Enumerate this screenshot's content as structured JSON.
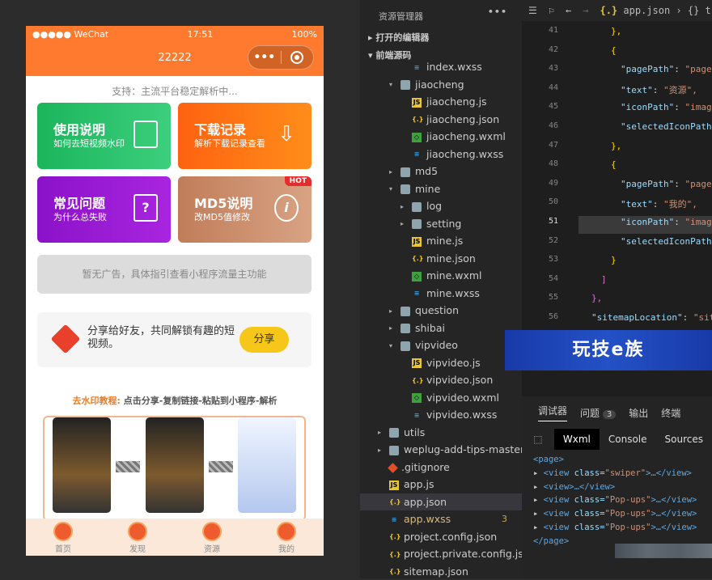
{
  "phone": {
    "status": {
      "carrier": "●●●●● WeChat",
      "time": "17:51",
      "battery": "100%"
    },
    "nav_title": "22222",
    "capsule": {
      "more": "•••"
    },
    "support": "支持：主流平台稳定解析中...",
    "cards": [
      {
        "title": "使用说明",
        "sub": "如何去短视频水印",
        "icon": "book-icon",
        "color": "#1bb55c"
      },
      {
        "title": "下载记录",
        "sub": "解析下载记录查看",
        "icon": "download-icon",
        "color": "#ff6210"
      },
      {
        "title": "常见问题",
        "sub": "为什么总失败",
        "icon": "question-doc-icon",
        "color": "#8b12c9"
      },
      {
        "title": "MD5说明",
        "sub": "改MD5值修改",
        "icon": "info-icon",
        "color": "#c17d5a",
        "badge": "HOT"
      }
    ],
    "ad": "暂无广告，具体指引查看小程序流量主功能",
    "share": {
      "text": "分享给好友，共同解锁有趣的短视频。",
      "button": "分享"
    },
    "tutorial": {
      "title_a": "去水印教程:",
      "title_b": " 点击分享-复制链接-粘贴到小程序-解析"
    },
    "tabs": [
      "首页",
      "发现",
      "资源",
      "我的"
    ]
  },
  "explorer": {
    "title": "资源管理器",
    "more": "•••",
    "sections": [
      "打开的编辑器",
      "前端源码"
    ],
    "tree": [
      {
        "ind": 2,
        "type": "wxss",
        "name": "index.wxss"
      },
      {
        "ind": 1,
        "type": "folder",
        "open": true,
        "name": "jiaocheng"
      },
      {
        "ind": 2,
        "type": "js",
        "name": "jiaocheng.js"
      },
      {
        "ind": 2,
        "type": "json",
        "name": "jiaocheng.json"
      },
      {
        "ind": 2,
        "type": "wxml",
        "name": "jiaocheng.wxml"
      },
      {
        "ind": 2,
        "type": "wxss",
        "name": "jiaocheng.wxss"
      },
      {
        "ind": 1,
        "type": "folder",
        "open": false,
        "name": "md5"
      },
      {
        "ind": 1,
        "type": "folder",
        "open": true,
        "name": "mine"
      },
      {
        "ind": 2,
        "type": "folder",
        "open": false,
        "name": "log"
      },
      {
        "ind": 2,
        "type": "folder",
        "open": false,
        "name": "setting"
      },
      {
        "ind": 2,
        "type": "js",
        "name": "mine.js"
      },
      {
        "ind": 2,
        "type": "json",
        "name": "mine.json"
      },
      {
        "ind": 2,
        "type": "wxml",
        "name": "mine.wxml"
      },
      {
        "ind": 2,
        "type": "wxss",
        "name": "mine.wxss"
      },
      {
        "ind": 1,
        "type": "folder",
        "open": false,
        "name": "question"
      },
      {
        "ind": 1,
        "type": "folder",
        "open": false,
        "name": "shibai"
      },
      {
        "ind": 1,
        "type": "folder",
        "open": true,
        "name": "vipvideo"
      },
      {
        "ind": 2,
        "type": "js",
        "name": "vipvideo.js"
      },
      {
        "ind": 2,
        "type": "json",
        "name": "vipvideo.json"
      },
      {
        "ind": 2,
        "type": "wxml",
        "name": "vipvideo.wxml"
      },
      {
        "ind": 2,
        "type": "wxss",
        "name": "vipvideo.wxss"
      },
      {
        "ind": 0,
        "type": "folder",
        "open": false,
        "name": "utils"
      },
      {
        "ind": 0,
        "type": "folder",
        "open": false,
        "name": "weplug-add-tips-master"
      },
      {
        "ind": 0,
        "type": "git",
        "name": ".gitignore"
      },
      {
        "ind": 0,
        "type": "js",
        "name": "app.js"
      },
      {
        "ind": 0,
        "type": "json",
        "name": "app.json",
        "selected": true
      },
      {
        "ind": 0,
        "type": "wxss",
        "name": "app.wxss",
        "badge": "3"
      },
      {
        "ind": 0,
        "type": "json",
        "name": "project.config.json"
      },
      {
        "ind": 0,
        "type": "json",
        "name": "project.private.config.js..."
      },
      {
        "ind": 0,
        "type": "json",
        "name": "sitemap.json"
      }
    ]
  },
  "editor": {
    "breadcrumb_file": "app.json",
    "breadcrumb_rest": "› {} t",
    "lines": [
      {
        "n": "41",
        "code": [
          {
            "c": "p",
            "t": "},"
          }
        ]
      },
      {
        "n": "42",
        "code": [
          {
            "c": "p",
            "t": "{"
          }
        ]
      },
      {
        "n": "43",
        "code": [
          {
            "c": "k",
            "t": "\"pagePath\""
          },
          {
            "c": "",
            "t": ": "
          },
          {
            "c": "s",
            "t": "\"pages"
          }
        ]
      },
      {
        "n": "44",
        "code": [
          {
            "c": "k",
            "t": "\"text\""
          },
          {
            "c": "",
            "t": ": "
          },
          {
            "c": "s",
            "t": "\"资源\","
          }
        ]
      },
      {
        "n": "45",
        "code": [
          {
            "c": "k",
            "t": "\"iconPath\""
          },
          {
            "c": "",
            "t": ": "
          },
          {
            "c": "s",
            "t": "\"image"
          }
        ]
      },
      {
        "n": "46",
        "code": [
          {
            "c": "k",
            "t": "\"selectedIconPath\""
          }
        ]
      },
      {
        "n": "47",
        "code": [
          {
            "c": "p",
            "t": "},"
          }
        ]
      },
      {
        "n": "48",
        "code": [
          {
            "c": "p",
            "t": "{"
          }
        ]
      },
      {
        "n": "49",
        "code": [
          {
            "c": "k",
            "t": "\"pagePath\""
          },
          {
            "c": "",
            "t": ": "
          },
          {
            "c": "s",
            "t": "\"pages"
          }
        ]
      },
      {
        "n": "50",
        "code": [
          {
            "c": "k",
            "t": "\"text\""
          },
          {
            "c": "",
            "t": ": "
          },
          {
            "c": "s",
            "t": "\"我的\","
          }
        ]
      },
      {
        "n": "51",
        "code": [
          {
            "c": "k",
            "t": "\"iconPath\""
          },
          {
            "c": "",
            "t": ": "
          },
          {
            "c": "s",
            "t": "\"image"
          }
        ]
      },
      {
        "n": "52",
        "code": [
          {
            "c": "k",
            "t": "\"selectedIconPath\""
          }
        ]
      },
      {
        "n": "53",
        "code": [
          {
            "c": "p",
            "t": "}"
          }
        ]
      },
      {
        "n": "54",
        "code": [
          {
            "c": "pk",
            "t": "]"
          }
        ]
      },
      {
        "n": "55",
        "code": [
          {
            "c": "pk",
            "t": "},"
          }
        ]
      },
      {
        "n": "56",
        "code": [
          {
            "c": "k",
            "t": "\"sitemapLocation\""
          },
          {
            "c": "",
            "t": ": "
          },
          {
            "c": "s",
            "t": "\"site"
          }
        ]
      }
    ]
  },
  "banner": "玩技e族",
  "devtools": {
    "top_tabs": [
      "调试器",
      "问题",
      "输出",
      "终端"
    ],
    "problem_count": "3",
    "panels": [
      "Wxml",
      "Console",
      "Sources"
    ],
    "wxml": [
      {
        "tag": "<page>",
        "arrow": ""
      },
      {
        "tag": "<view",
        "arrow": "▸",
        "attr": "class=",
        "val": "\"swiper\"",
        "end": ">…</view>"
      },
      {
        "tag": "<view>",
        "arrow": "▸",
        "end": "…</view>"
      },
      {
        "tag": "<view",
        "arrow": "▸",
        "attr": "class=",
        "val": "\"Pop-ups\"",
        "end": ">…</view>"
      },
      {
        "tag": "<view",
        "arrow": "▸",
        "attr": "class=",
        "val": "\"Pop-ups\"",
        "end": ">…</view>"
      },
      {
        "tag": "<view",
        "arrow": "▸",
        "attr": "class=",
        "val": "\"Pop-ups\"",
        "end": ">…</view>"
      },
      {
        "tag": "</page>",
        "arrow": ""
      }
    ]
  }
}
